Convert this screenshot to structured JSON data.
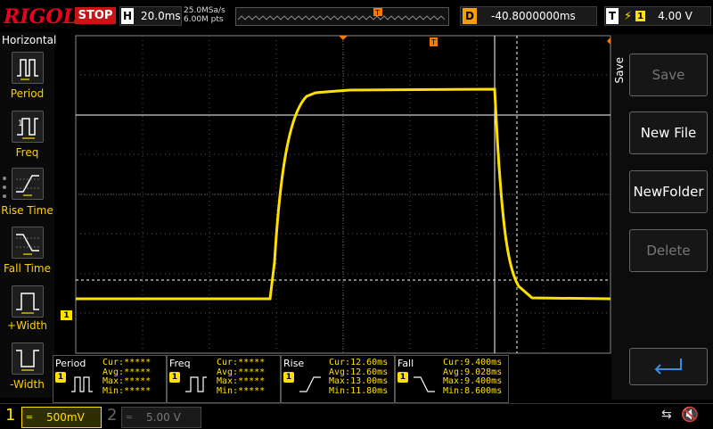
{
  "top": {
    "brand": "RIGOL",
    "run_state": "STOP",
    "timebase_letter": "H",
    "timebase": "20.0ms",
    "sample_rate": "25.0MSa/s",
    "mem_depth": "6.00M pts",
    "delay_letter": "D",
    "delay": "-40.8000000ms",
    "trigger_letter": "T",
    "trigger_channel": "1",
    "trigger_level": "4.00 V"
  },
  "left_menu": {
    "title": "Horizontal",
    "items": [
      {
        "label": "Period",
        "icon": "period-icon"
      },
      {
        "label": "Freq",
        "icon": "freq-icon"
      },
      {
        "label": "Rise Time",
        "icon": "rise-time-icon"
      },
      {
        "label": "Fall Time",
        "icon": "fall-time-icon"
      },
      {
        "label": "+Width",
        "icon": "plus-width-icon"
      },
      {
        "label": "-Width",
        "icon": "minus-width-icon"
      }
    ]
  },
  "right_menu": {
    "title": "Save",
    "buttons": [
      {
        "label": "Save",
        "enabled": false
      },
      {
        "label": "New File",
        "enabled": true
      },
      {
        "label": "NewFolder",
        "enabled": true
      },
      {
        "label": "Delete",
        "enabled": false
      }
    ],
    "enter_icon": "enter-icon"
  },
  "measurements": [
    {
      "name": "Period",
      "cur": "Cur:*****",
      "avg": "Avg:*****",
      "max": "Max:*****",
      "min": "Min:*****"
    },
    {
      "name": "Freq",
      "cur": "Cur:*****",
      "avg": "Avg:*****",
      "max": "Max:*****",
      "min": "Min:*****"
    },
    {
      "name": "Rise",
      "cur": "Cur:12.60ms",
      "avg": "Avg:12.60ms",
      "max": "Max:13.00ms",
      "min": "Min:11.80ms"
    },
    {
      "name": "Fall",
      "cur": "Cur:9.400ms",
      "avg": "Avg:9.028ms",
      "max": "Max:9.400ms",
      "min": "Min:8.600ms"
    }
  ],
  "channels": {
    "ch1_label": "1",
    "ch1_scale": "500mV",
    "ch2_label": "2",
    "ch2_scale": "5.00 V",
    "ch1_marker": "1"
  },
  "status_icons": [
    "usb-icon",
    "speaker-muted-icon"
  ],
  "colors": {
    "ch1": "#ffe000",
    "trigger": "#f47a00",
    "brand": "#e8001c"
  }
}
